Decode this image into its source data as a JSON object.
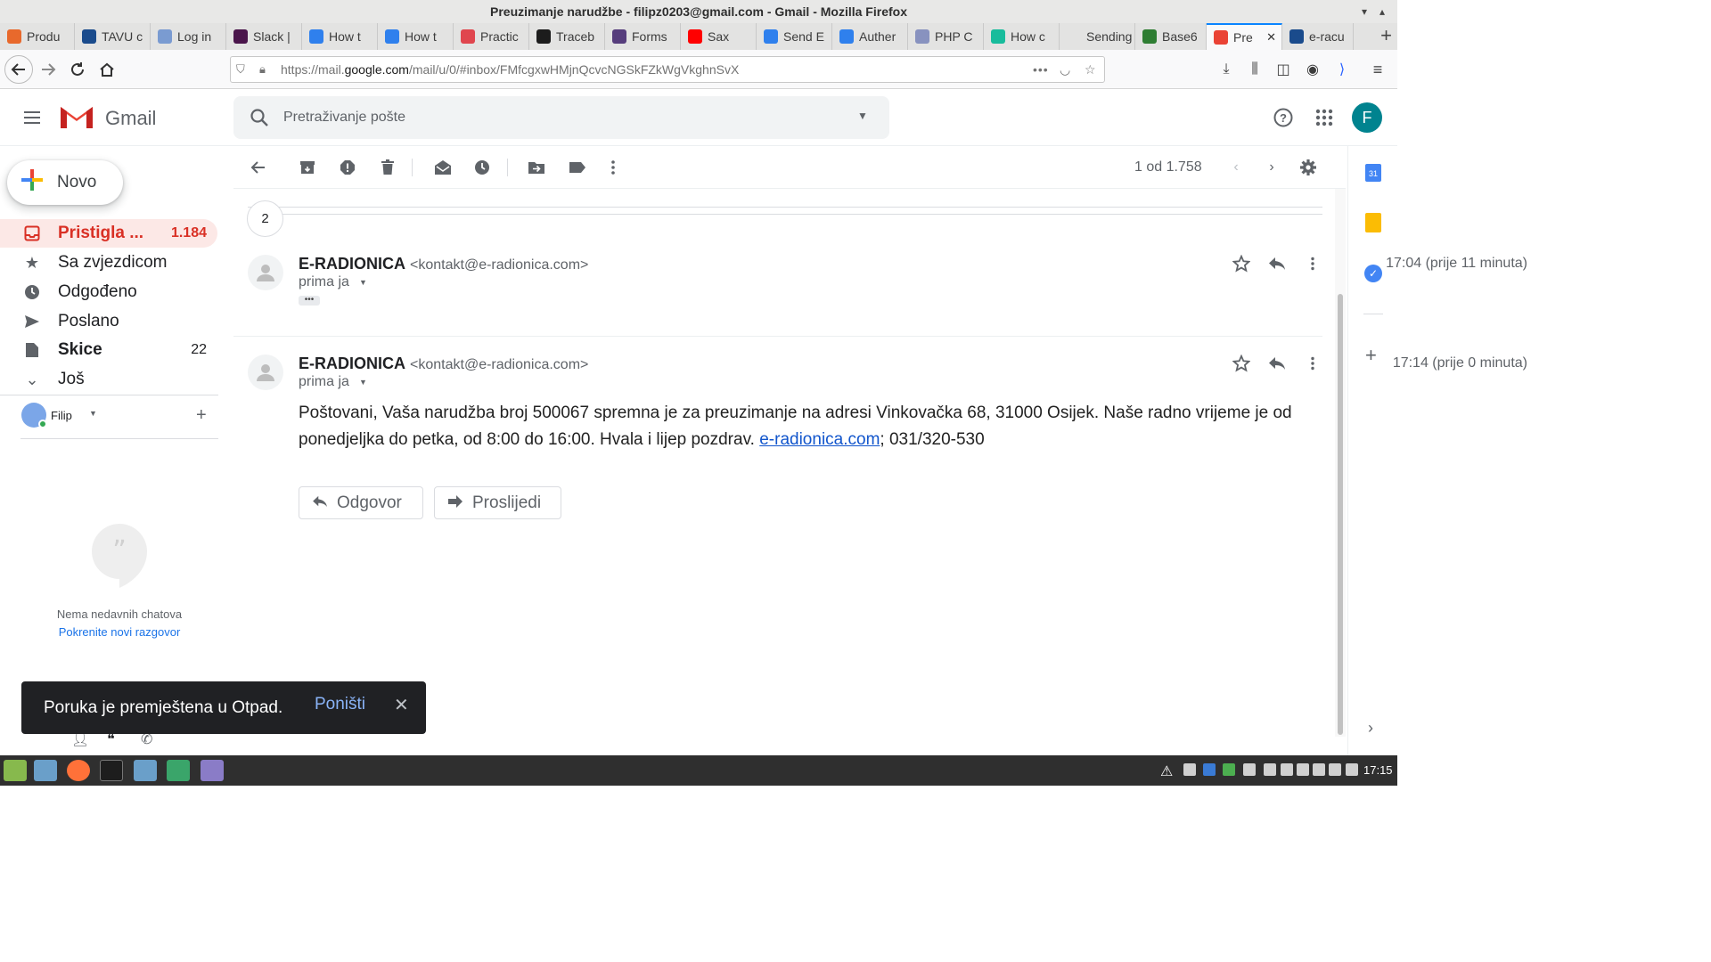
{
  "window": {
    "title": "Preuzimanje narudžbe - filipz0203@gmail.com - Gmail - Mozilla Firefox"
  },
  "tabs": [
    {
      "label": "Produ",
      "color": "#e8692c"
    },
    {
      "label": "TAVU c",
      "color": "#1a4b8c"
    },
    {
      "label": "Log in",
      "color": "#7a9bd1"
    },
    {
      "label": "Slack |",
      "color": "#4a154b"
    },
    {
      "label": "How t",
      "color": "#2f80ed"
    },
    {
      "label": "How t",
      "color": "#2f80ed"
    },
    {
      "label": "Practic",
      "color": "#e0464e"
    },
    {
      "label": "Traceb",
      "color": "#1c1c1c"
    },
    {
      "label": "Forms",
      "color": "#563d7c"
    },
    {
      "label": "Sax",
      "color": "#ff0000"
    },
    {
      "label": "Send E",
      "color": "#2f80ed"
    },
    {
      "label": "Auther",
      "color": "#2f80ed"
    },
    {
      "label": "PHP C",
      "color": "#8892bf"
    },
    {
      "label": "How c",
      "color": "#18bc9c"
    },
    {
      "label": "Sending M",
      "color": "#e3e3e2"
    },
    {
      "label": "Base6",
      "color": "#2e7d32"
    },
    {
      "label": "Pre",
      "color": "#ea4335"
    },
    {
      "label": "e-racu",
      "color": "#1a4b8c"
    }
  ],
  "url": {
    "prefix": "https://mail.",
    "domain": "google.com",
    "path": "/mail/u/0/#inbox/FMfcgxwHMjnQcvcNGSkFZkWgVkghnSvX"
  },
  "gmail": {
    "logo_text": "Gmail",
    "search_placeholder": "Pretraživanje pošte",
    "avatar_letter": "F"
  },
  "sidebar": {
    "compose_label": "Novo",
    "items": [
      {
        "label": "Pristigla ...",
        "count": "1.184"
      },
      {
        "label": "Sa zvjezdicom",
        "count": ""
      },
      {
        "label": "Odgođeno",
        "count": ""
      },
      {
        "label": "Poslano",
        "count": ""
      },
      {
        "label": "Skice",
        "count": "22"
      },
      {
        "label": "Još",
        "count": ""
      }
    ],
    "hangouts_user": "Filip",
    "no_chats": "Nema nedavnih chatova",
    "start_chat": "Pokrenite novi razgovor"
  },
  "toolbar": {
    "pagination": "1 od 1.758"
  },
  "thread": {
    "collapsed_count": "2",
    "messages": [
      {
        "sender": "E-RADIONICA",
        "email": "<kontakt@e-radionica.com>",
        "to": "prima ja",
        "time": "17:04 (prije 11 minuta)"
      },
      {
        "sender": "E-RADIONICA",
        "email": "<kontakt@e-radionica.com>",
        "to": "prima ja",
        "time": "17:14 (prije 0 minuta)"
      }
    ],
    "body_text": "Poštovani, Vaša narudžba broj 500067 spremna je za preuzimanje na adresi Vinkovačka 68, 31000 Osijek. Naše radno vrijeme je od ponedjeljka do petka, od 8:00 do 16:00. Hvala i lijep pozdrav. ",
    "body_link": "e-radionica.com",
    "body_tail": "; 031/320-530",
    "reply_label": "Odgovor",
    "forward_label": "Proslijedi"
  },
  "snackbar": {
    "message": "Poruka je premještena u Otpad.",
    "undo": "Poništi"
  },
  "taskbar": {
    "clock": "17:15"
  }
}
